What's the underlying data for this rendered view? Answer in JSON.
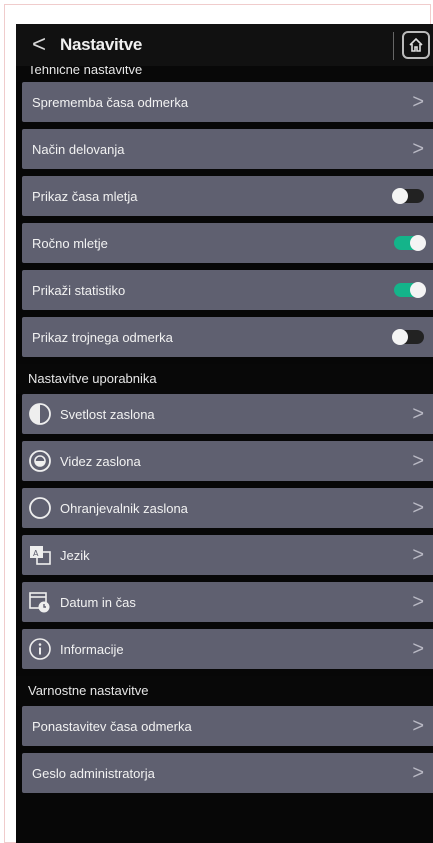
{
  "header": {
    "title": "Nastavitve",
    "back_glyph": "<",
    "home_icon": "home-icon"
  },
  "sections": {
    "technical": "Tehnične nastavitve",
    "user": "Nastavitve uporabnika",
    "safety": "Varnostne nastavitve"
  },
  "technical_items": [
    {
      "label": "Sprememba časa odmerka",
      "type": "chevron"
    },
    {
      "label": "Način delovanja",
      "type": "chevron"
    },
    {
      "label": "Prikaz časa mletja",
      "type": "toggle",
      "on": false
    },
    {
      "label": "Ročno mletje",
      "type": "toggle",
      "on": true
    },
    {
      "label": "Prikaži statistiko",
      "type": "toggle",
      "on": true
    },
    {
      "label": "Prikaz trojnega odmerka",
      "type": "toggle",
      "on": false
    }
  ],
  "user_items": [
    {
      "label": "Svetlost zaslona",
      "icon": "brightness-icon"
    },
    {
      "label": "Videz zaslona",
      "icon": "appearance-icon"
    },
    {
      "label": "Ohranjevalnik zaslona",
      "icon": "screensaver-icon"
    },
    {
      "label": "Jezik",
      "icon": "language-icon"
    },
    {
      "label": "Datum in čas",
      "icon": "calendar-clock-icon"
    },
    {
      "label": "Informacije",
      "icon": "info-icon"
    }
  ],
  "safety_items": [
    {
      "label": "Ponastavitev časa odmerka"
    },
    {
      "label": "Geslo administratorja"
    }
  ],
  "colors": {
    "row": "#5f6070",
    "toggle_on": "#14b48a",
    "background": "#070707"
  },
  "chevron_glyph": ">"
}
